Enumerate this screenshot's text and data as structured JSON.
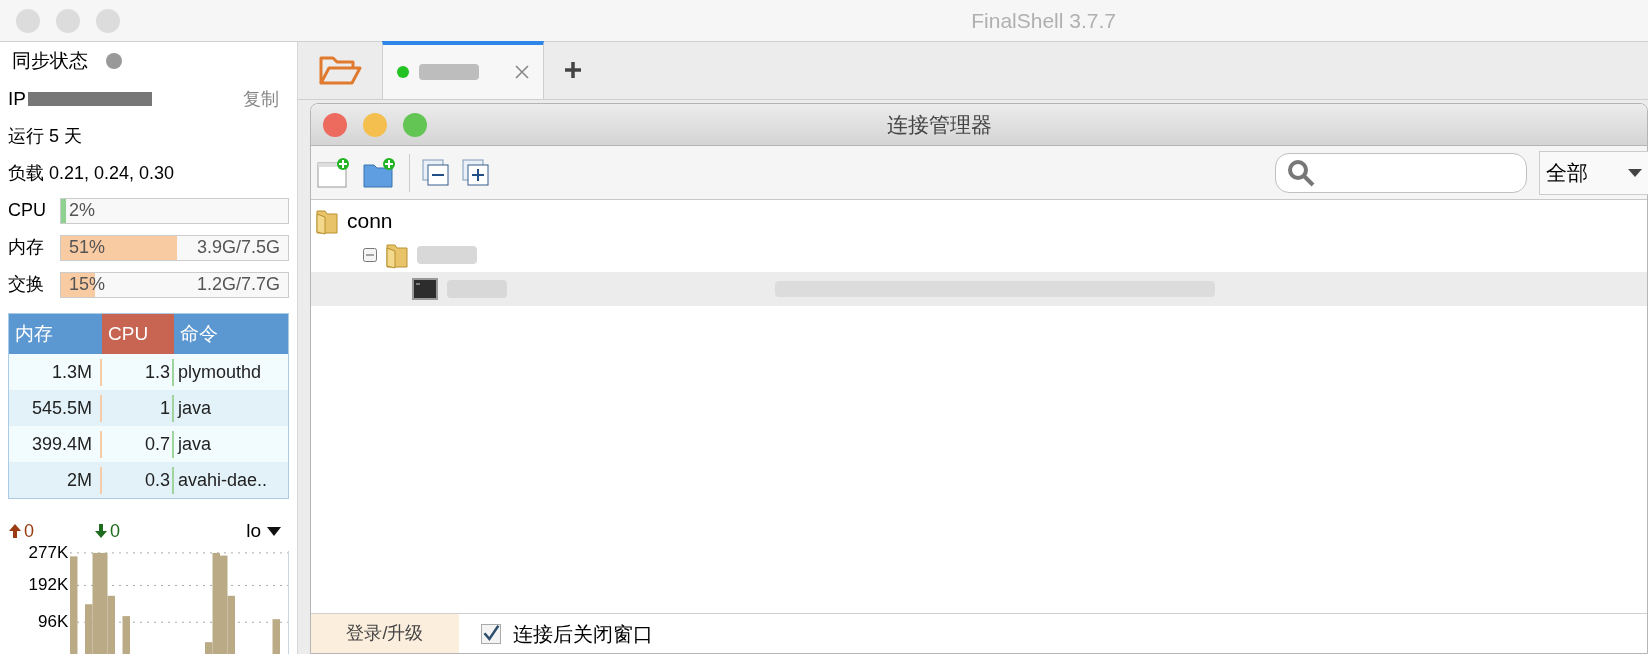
{
  "window": {
    "title": "FinalShell 3.7.7"
  },
  "sidebar": {
    "sync_label": "同步状态",
    "ip_label": "IP",
    "copy": "复制",
    "uptime": "运行 5 天",
    "load": "负载 0.21, 0.24, 0.30",
    "meters": [
      {
        "label": "CPU",
        "percent": "2%",
        "level": 0.02,
        "color": "#8fd18f"
      },
      {
        "label": "内存",
        "percent": "51%",
        "detail": "3.9G/7.5G",
        "level": 0.51,
        "color": "#f9cba3"
      },
      {
        "label": "交换",
        "percent": "15%",
        "detail": "1.2G/7.7G",
        "level": 0.15,
        "color": "#f9cba3"
      }
    ],
    "processes": {
      "columns": [
        "内存",
        "CPU",
        "命令"
      ],
      "rows": [
        {
          "memory": "1.3M",
          "cpu": "1.3",
          "command": "plymouthd"
        },
        {
          "memory": "545.5M",
          "cpu": "1",
          "command": "java"
        },
        {
          "memory": "399.4M",
          "cpu": "0.7",
          "command": "java"
        },
        {
          "memory": "2M",
          "cpu": "0.3",
          "command": "avahi-dae.."
        }
      ]
    },
    "network": {
      "upload": "0",
      "download": "0",
      "interface": "lo",
      "chart_data": {
        "type": "bar",
        "ylim": [
          0,
          282
        ],
        "yticks": [
          {
            "value": 96,
            "label": "96K"
          },
          {
            "value": 192,
            "label": "192K"
          },
          {
            "value": 277,
            "label": "277K"
          }
        ],
        "values": [
          268,
          0,
          143,
          277,
          277,
          165,
          0,
          112,
          0,
          0,
          0,
          0,
          0,
          0,
          0,
          0,
          0,
          0,
          44,
          277,
          270,
          165,
          0,
          0,
          0,
          0,
          0,
          104,
          0,
          0
        ]
      }
    }
  },
  "tabs": [
    {
      "selected": true,
      "color": "#22c322"
    }
  ],
  "dialog": {
    "title": "连接管理器",
    "filter": "全部",
    "tree": [
      {
        "kind": "folder",
        "label": "conn",
        "selected": false,
        "children": [
          {
            "kind": "folder",
            "expanded": true,
            "selected": false,
            "children": [
              {
                "kind": "host",
                "selected": true
              }
            ]
          }
        ]
      }
    ],
    "login_button": "登录/升级",
    "close_after_connect": {
      "label": "连接后关闭窗口",
      "checked": true
    }
  }
}
